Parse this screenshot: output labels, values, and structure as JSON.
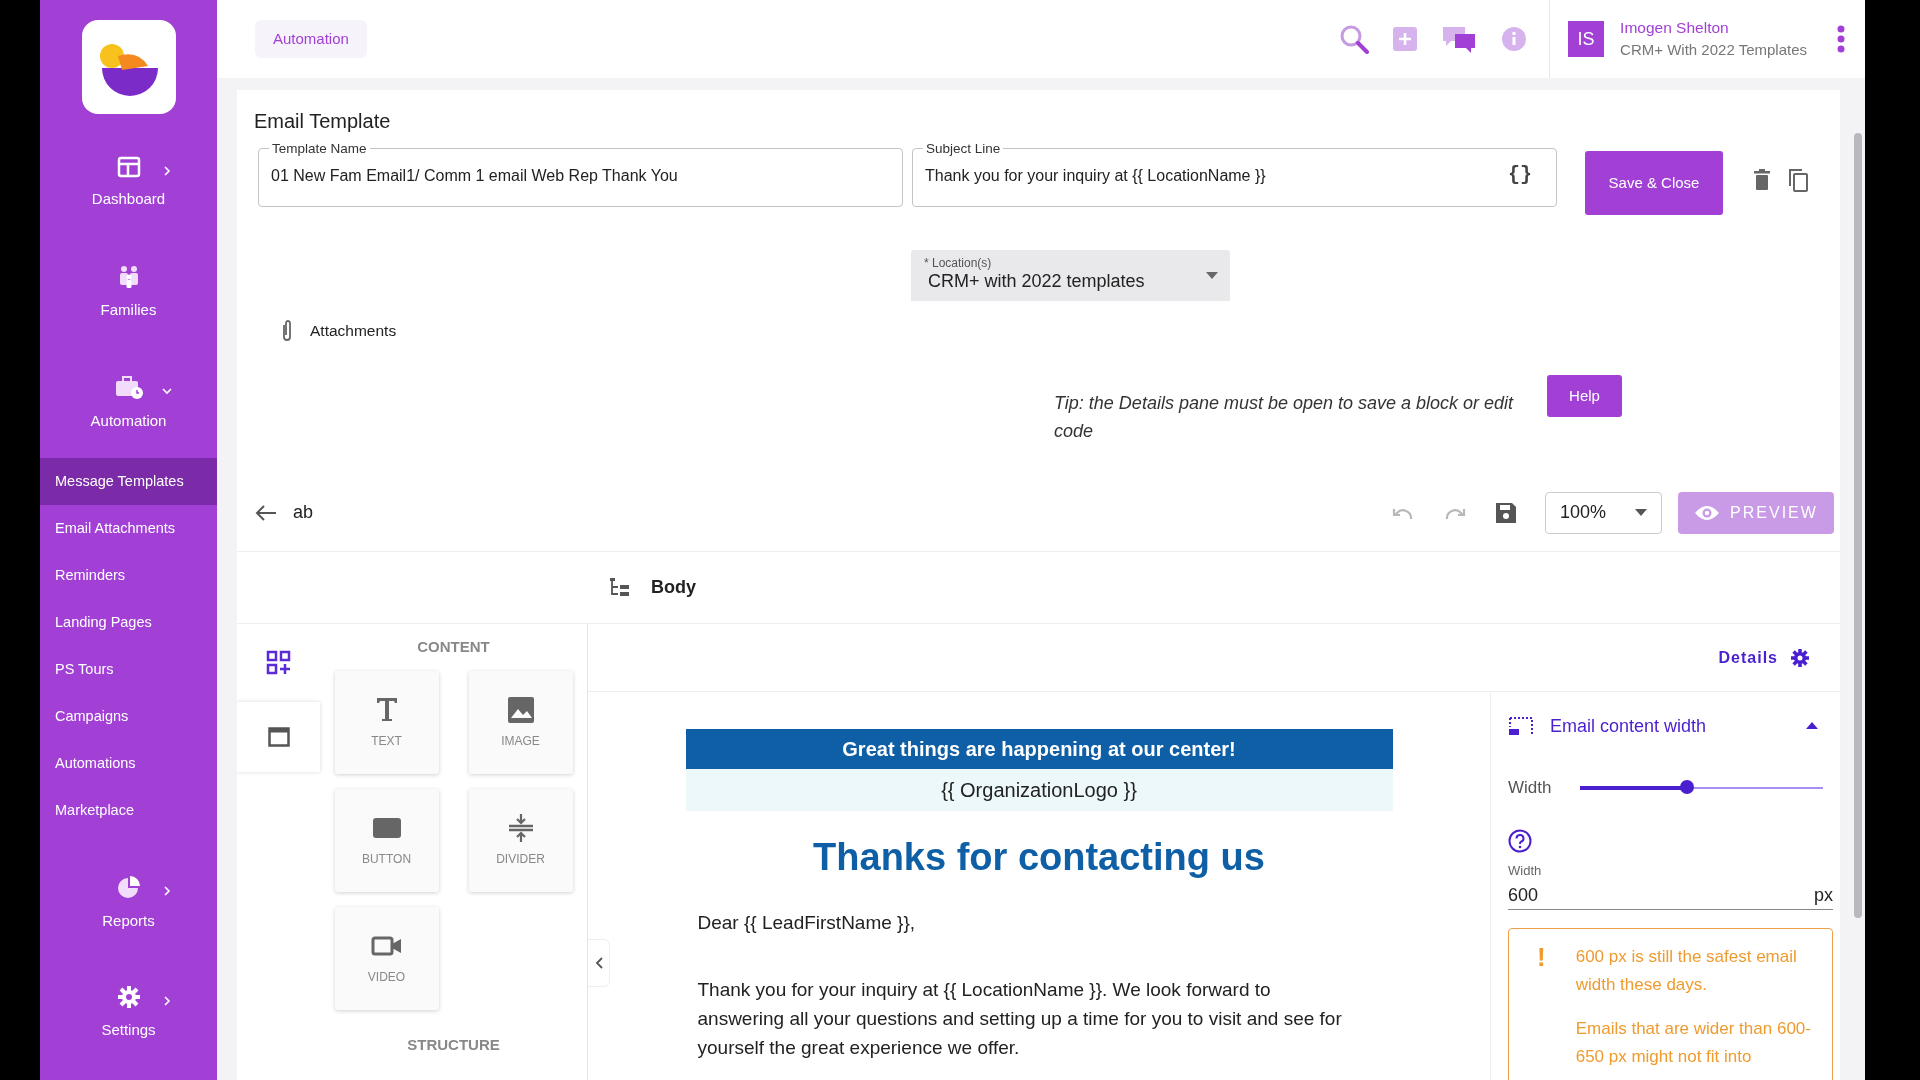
{
  "sidebar": {
    "sections": [
      {
        "label": "Dashboard",
        "expanded": false
      },
      {
        "label": "Families"
      },
      {
        "label": "Automation",
        "expanded": true,
        "children": [
          {
            "label": "Message Templates",
            "selected": true
          },
          {
            "label": "Email Attachments",
            "selected": false
          },
          {
            "label": "Reminders",
            "selected": false
          },
          {
            "label": "Landing Pages",
            "selected": false
          },
          {
            "label": "PS Tours",
            "selected": false
          },
          {
            "label": "Campaigns",
            "selected": false
          },
          {
            "label": "Automations",
            "selected": false
          },
          {
            "label": "Marketplace",
            "selected": false
          }
        ]
      },
      {
        "label": "Reports",
        "expanded": false
      },
      {
        "label": "Settings",
        "expanded": false
      }
    ]
  },
  "top_bar": {
    "breadcrumb": "Automation",
    "user": {
      "initials": "IS",
      "name": "Imogen Shelton",
      "organization": "CRM+ With 2022 Templates"
    }
  },
  "template": {
    "title": "Email Template",
    "template_name": {
      "label": "Template Name",
      "value": "01 New Fam Email1/ Comm 1 email Web Rep Thank You"
    },
    "subject_line": {
      "label": "Subject Line",
      "value": "Thank you for your inquiry at {{ LocationName }}",
      "merge_tag_button": "{}"
    },
    "save_button": "Save & Close",
    "location": {
      "label": "* Location(s)",
      "value": "CRM+ with 2022 templates"
    },
    "attachments": "Attachments",
    "tip": "Tip: the Details pane must be open to save a block or edit code",
    "help_button": "Help"
  },
  "editor": {
    "template_label": "ab",
    "undo": {
      "disabled": true
    },
    "redo": {
      "disabled": true
    },
    "zoom": "100%",
    "preview": {
      "label": "PREVIEW",
      "disabled": true
    },
    "breadcrumb": "Body",
    "panel_tabs": [
      {
        "selected": true
      },
      {
        "selected": false
      }
    ],
    "content_heading": "CONTENT",
    "blocks": [
      {
        "label": "TEXT"
      },
      {
        "label": "IMAGE"
      },
      {
        "label": "BUTTON"
      },
      {
        "label": "DIVIDER"
      },
      {
        "label": "VIDEO"
      }
    ],
    "structure_heading": "STRUCTURE",
    "email": {
      "banner": "Great things are happening at our center!",
      "logo": "{{ OrganizationLogo }}",
      "heading": "Thanks for contacting us",
      "paragraphs": [
        "Dear {{ LeadFirstName }},",
        "Thank you for your inquiry at {{ LocationName }}. We look forward to answering all your questions and setting up a time for you to visit and see for yourself the great experience we offer."
      ]
    },
    "details": {
      "label": "Details",
      "section": {
        "title": "Email content width",
        "expanded": true,
        "slider_label": "Width",
        "level": 0.44,
        "field_label": "Width",
        "value": "600",
        "unit": "px",
        "warning_mark": "!",
        "warning": [
          "600 px is still the safest email width these days.",
          "Emails that are wider than 600-650 px might not fit into"
        ]
      }
    }
  }
}
